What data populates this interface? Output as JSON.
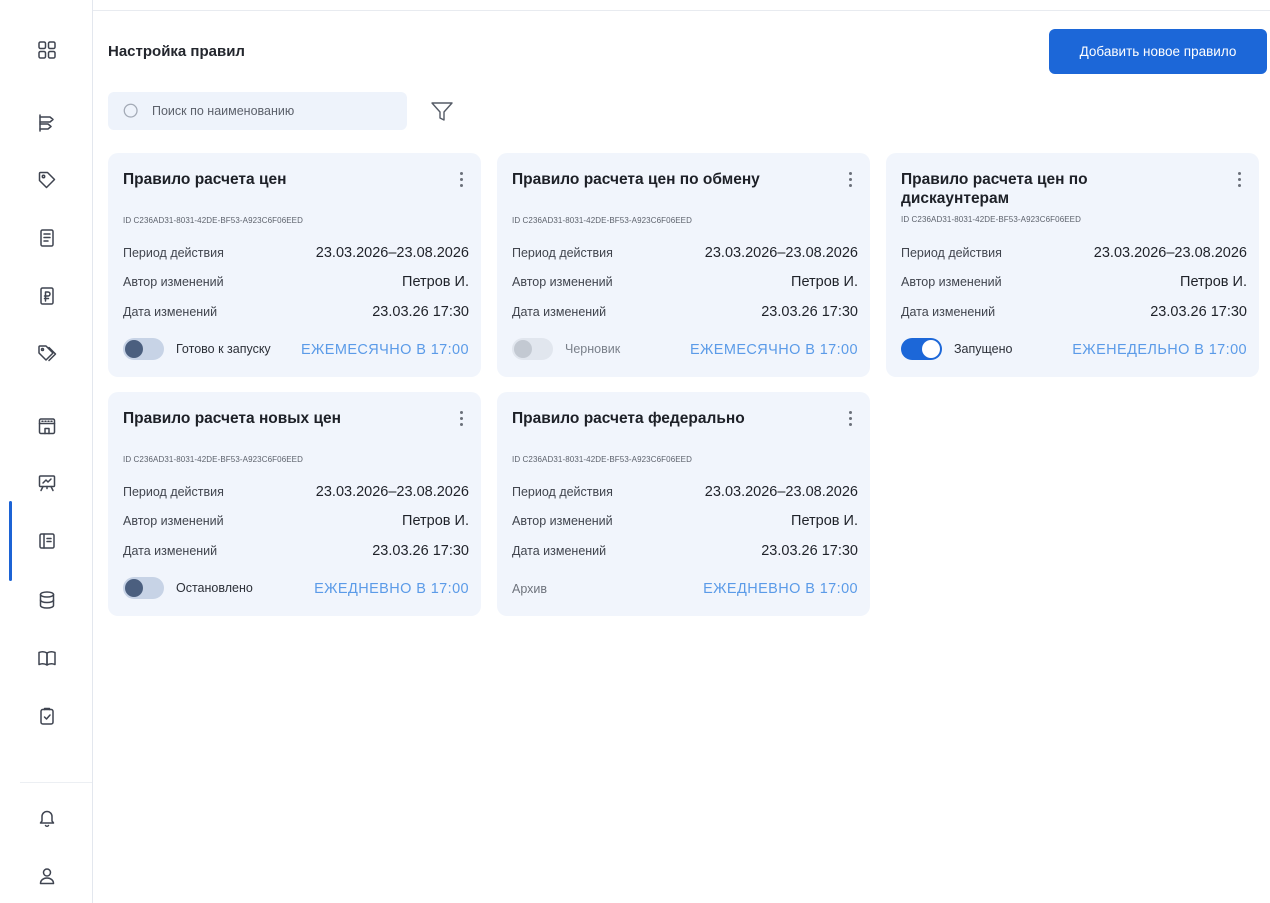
{
  "header": {
    "title": "Настройка правил",
    "add_button": "Добавить новое правило"
  },
  "search": {
    "placeholder": "Поиск по наименованию"
  },
  "sidebar": {
    "items": [
      {
        "icon": "grid-icon"
      },
      {
        "icon": "hierarchy-icon"
      },
      {
        "icon": "tag-icon"
      },
      {
        "icon": "document-icon"
      },
      {
        "icon": "ruble-receipt-icon"
      },
      {
        "icon": "tags-icon"
      },
      {
        "icon": "store-icon"
      },
      {
        "icon": "presentation-icon"
      },
      {
        "icon": "rules-icon",
        "active": true
      },
      {
        "icon": "database-icon"
      },
      {
        "icon": "book-icon"
      },
      {
        "icon": "clipboard-check-icon"
      },
      {
        "icon": "bell-icon"
      },
      {
        "icon": "user-icon"
      }
    ]
  },
  "labels": {
    "period": "Период действия",
    "author": "Автор изменений",
    "date": "Дата изменений"
  },
  "cards": [
    {
      "title": "Правило расчета цен",
      "id": "ID C236AD31-8031-42DE-BF53-A923C6F06EED",
      "period": "23.03.2026–23.08.2026",
      "author": "Петров И.",
      "date": "23.03.26 17:30",
      "status": "Готово к запуску",
      "toggle": "off",
      "schedule": "ЕЖЕМЕСЯЧНО В 17:00"
    },
    {
      "title": "Правило расчета цен по обмену",
      "id": "ID C236AD31-8031-42DE-BF53-A923C6F06EED",
      "period": "23.03.2026–23.08.2026",
      "author": "Петров И.",
      "date": "23.03.26 17:30",
      "status": "Черновик",
      "toggle": "disabled",
      "schedule": "ЕЖЕМЕСЯЧНО В 17:00"
    },
    {
      "title": "Правило расчета цен  по дискаунтерам",
      "id": "ID C236AD31-8031-42DE-BF53-A923C6F06EED",
      "period": "23.03.2026–23.08.2026",
      "author": "Петров И.",
      "date": "23.03.26 17:30",
      "status": "Запущено",
      "toggle": "on",
      "schedule": "ЕЖЕНЕДЕЛЬНО В 17:00"
    },
    {
      "title": "Правило расчета новых цен",
      "id": "ID C236AD31-8031-42DE-BF53-A923C6F06EED",
      "period": "23.03.2026–23.08.2026",
      "author": "Петров И.",
      "date": "23.03.26 17:30",
      "status": "Остановлено",
      "toggle": "off",
      "schedule": "ЕЖЕДНЕВНО В 17:00"
    },
    {
      "title": "Правило расчета федерально",
      "id": "ID C236AD31-8031-42DE-BF53-A923C6F06EED",
      "period": "23.03.2026–23.08.2026",
      "author": "Петров И.",
      "date": "23.03.26 17:30",
      "status": "Архив",
      "toggle": "none",
      "schedule": "ЕЖЕДНЕВНО В 17:00"
    }
  ]
}
